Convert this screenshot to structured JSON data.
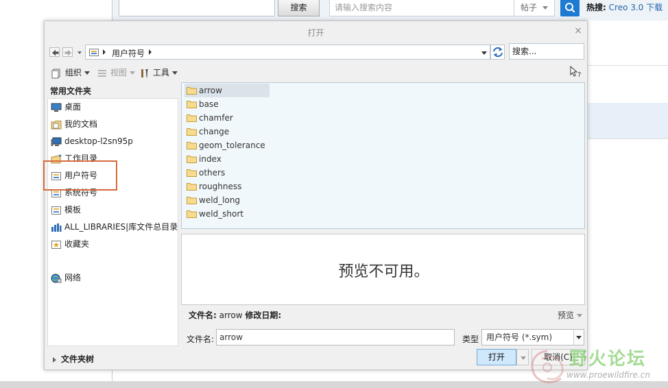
{
  "background_page": {
    "search_button_label": "搜索",
    "search_placeholder": "请输入搜索内容",
    "post_select_value": "帖子",
    "hot_label": "热搜:",
    "hot_link": "Creo 3.0 下载"
  },
  "dialog": {
    "title": "打开",
    "close_symbol": "×",
    "path_segment": "用户符号",
    "search_placeholder": "搜索...",
    "toolbar": {
      "organize": "组织",
      "view": "视图",
      "tools": "工具"
    },
    "sidebar": {
      "heading": "常用文件夹",
      "items": [
        {
          "label": "桌面",
          "icon": "desktop-icon"
        },
        {
          "label": "我的文档",
          "icon": "documents-icon"
        },
        {
          "label": "desktop-l2sn95p",
          "icon": "computer-icon"
        },
        {
          "label": "工作目录",
          "icon": "working-directory-icon"
        },
        {
          "label": "用户符号",
          "icon": "folder-icon"
        },
        {
          "label": "系统符号",
          "icon": "folder-icon"
        },
        {
          "label": "模板",
          "icon": "folder-icon"
        },
        {
          "label": "ALL_LIBRARIES|库文件总目录",
          "icon": "library-icon"
        },
        {
          "label": "收藏夹",
          "icon": "favorites-icon"
        },
        {
          "label": "网络",
          "icon": "network-icon"
        }
      ]
    },
    "files": [
      "arrow",
      "base",
      "chamfer",
      "change",
      "geom_tolerance",
      "index",
      "others",
      "roughness",
      "weld_long",
      "weld_short"
    ],
    "selected_file": "arrow",
    "preview_text": "预览不可用。",
    "info": {
      "filename_label": "文件名:",
      "filename_value": "arrow",
      "modified_label": "修改日期:"
    },
    "preview_toggle": "预览",
    "filename_field_label": "文件名:",
    "filename_field_value": "arrow",
    "type_label": "类型",
    "type_value": "用户符号 (*.sym)",
    "folder_tree_label": "文件夹树",
    "open_button": "打开",
    "cancel_button": "取消(C)"
  },
  "watermark": {
    "text": "野火论坛",
    "url": "www.proewildfire.cn"
  },
  "colors": {
    "accent": "#1f7ad2",
    "highlight_box": "#d46a3c",
    "list_bg": "#f1f8fb",
    "open_button_bg": "#d0e8fb"
  }
}
